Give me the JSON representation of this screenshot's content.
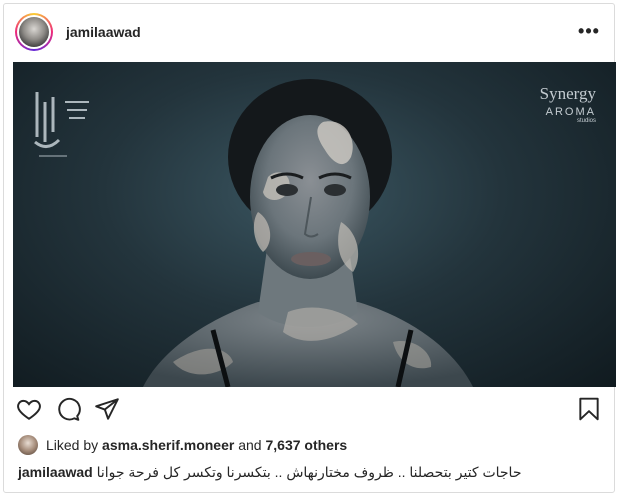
{
  "post": {
    "username": "jamilaawad",
    "more_label": "•••",
    "media": {
      "logo_left_text": "حكاية ورا حكاية",
      "brand_name": "Synergy",
      "brand_line2": "AROMA",
      "brand_line3": "studios"
    },
    "likes": {
      "prefix": "Liked by",
      "user": "asma.sherif.moneer",
      "middle": "and",
      "others": "7,637 others"
    },
    "caption": {
      "author": "jamilaawad",
      "text": "حاجات كتير بتحصلنا .. ظروف مختارنهاش .. بتكسرنا وتكسر كل فرحة جوانا"
    }
  },
  "icons": {
    "like": "heart-icon",
    "comment": "comment-icon",
    "share": "paper-plane-icon",
    "save": "bookmark-icon"
  },
  "colors": {
    "text": "#262626",
    "border": "#dbdbdb",
    "ring_start": "#f9ce34",
    "ring_mid": "#ee2a7b",
    "ring_end": "#6228d7"
  }
}
